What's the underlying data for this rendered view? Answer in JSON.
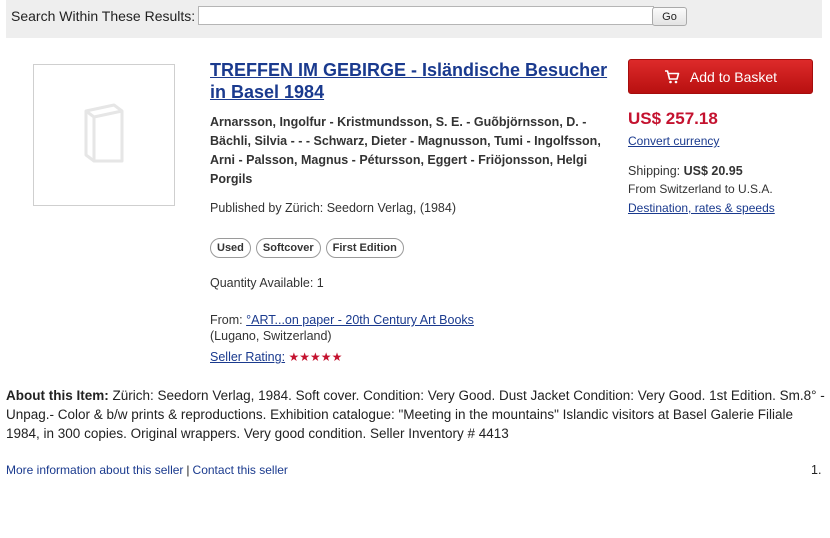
{
  "search": {
    "label": "Search Within These Results:",
    "value": "",
    "go_label": "Go"
  },
  "listing": {
    "title": "TREFFEN IM GEBIRGE - Isländische Besucher in Basel 1984",
    "authors": "Arnarsson, Ingolfur - Kristmundsson, S. E. - Guõbjörnsson, D. - Bächli, Silvia - - - Schwarz, Dieter - Magnusson, Tumi - Ingolfsson, Arni - Palsson, Magnus - Pétursson, Eggert - Friöjonsson, Helgi Porgils",
    "published": "Published by Zürich: Seedorn Verlag, (1984)",
    "badges": [
      "Used",
      "Softcover",
      "First Edition"
    ],
    "quantity": "Quantity Available: 1",
    "from_label": "From:",
    "seller_name": "°ART...on paper - 20th Century Art Books",
    "seller_location": "(Lugano, Switzerland)",
    "rating_label": "Seller Rating:",
    "rating_stars": "★★★★★",
    "rating_value": 5,
    "thumbnail_icon": "book-placeholder-icon"
  },
  "purchase": {
    "basket_label": "Add to Basket",
    "basket_icon": "cart-icon",
    "price": "US$ 257.18",
    "convert_label": "Convert currency",
    "shipping_label": "Shipping:",
    "shipping_price": "US$ 20.95",
    "shipping_route": "From Switzerland to U.S.A.",
    "destination_label": "Destination, rates & speeds"
  },
  "about": {
    "label": "About this Item:",
    "text": "Zürich: Seedorn Verlag, 1984. Soft cover. Condition: Very Good. Dust Jacket Condition: Very Good. 1st Edition. Sm.8° - Unpag.- Color & b/w prints & reproductions. Exhibition catalogue: \"Meeting in the mountains\" Islandic visitors at Basel Galerie Filiale 1984, in 300 copies. Original wrappers. Very good condition. Seller Inventory # 4413"
  },
  "footer": {
    "more_info_label": "More information about this seller",
    "separator": "|",
    "contact_label": "Contact this seller",
    "page_number": "1."
  },
  "colors": {
    "link": "#1a3a8e",
    "accent_red": "#c4122f",
    "search_bar_bg": "#eeeeee"
  }
}
